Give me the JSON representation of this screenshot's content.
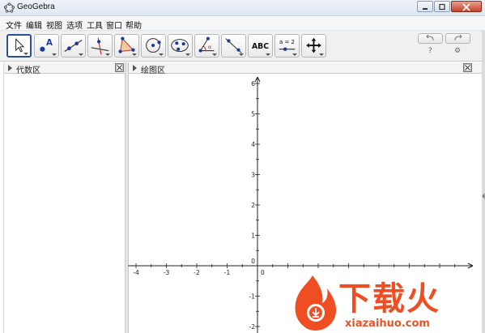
{
  "window": {
    "title": "GeoGebra"
  },
  "menu": {
    "items": [
      "文件",
      "编辑",
      "视图",
      "选项",
      "工具",
      "窗口",
      "帮助"
    ]
  },
  "toolbar": {
    "tools": [
      {
        "name": "move-tool",
        "icon": "arrow-cursor-icon"
      },
      {
        "name": "point-tool",
        "icon": "point-a-icon",
        "label": "A"
      },
      {
        "name": "line-tool",
        "icon": "line-through-points-icon"
      },
      {
        "name": "perpendicular-tool",
        "icon": "perpendicular-line-icon"
      },
      {
        "name": "polygon-tool",
        "icon": "polygon-icon"
      },
      {
        "name": "circle-tool",
        "icon": "circle-center-point-icon"
      },
      {
        "name": "conic-tool",
        "icon": "ellipse-icon"
      },
      {
        "name": "angle-tool",
        "icon": "angle-icon"
      },
      {
        "name": "reflect-tool",
        "icon": "reflect-about-line-icon"
      },
      {
        "name": "text-tool",
        "icon": "text-icon",
        "label": "ABC"
      },
      {
        "name": "slider-tool",
        "icon": "slider-icon",
        "label": "a = 2"
      },
      {
        "name": "move-view-tool",
        "icon": "move-graphics-view-icon"
      }
    ],
    "help_symbol": "?",
    "settings_symbol": "⚙"
  },
  "algebra_view": {
    "title": "代数区"
  },
  "graphics_view": {
    "title": "绘图区"
  },
  "axes": {
    "x_ticks": [
      "-4",
      "-3",
      "-2",
      "-1",
      "0"
    ],
    "y_ticks": [
      "6",
      "5",
      "4",
      "3",
      "2",
      "1",
      "0",
      "-1",
      "-2"
    ]
  },
  "watermark": {
    "brand_text": "下载火",
    "domain_text": "xiazaihuo.com"
  },
  "colors": {
    "accent": "#2a4f9a",
    "watermark": "#ef4e23"
  }
}
